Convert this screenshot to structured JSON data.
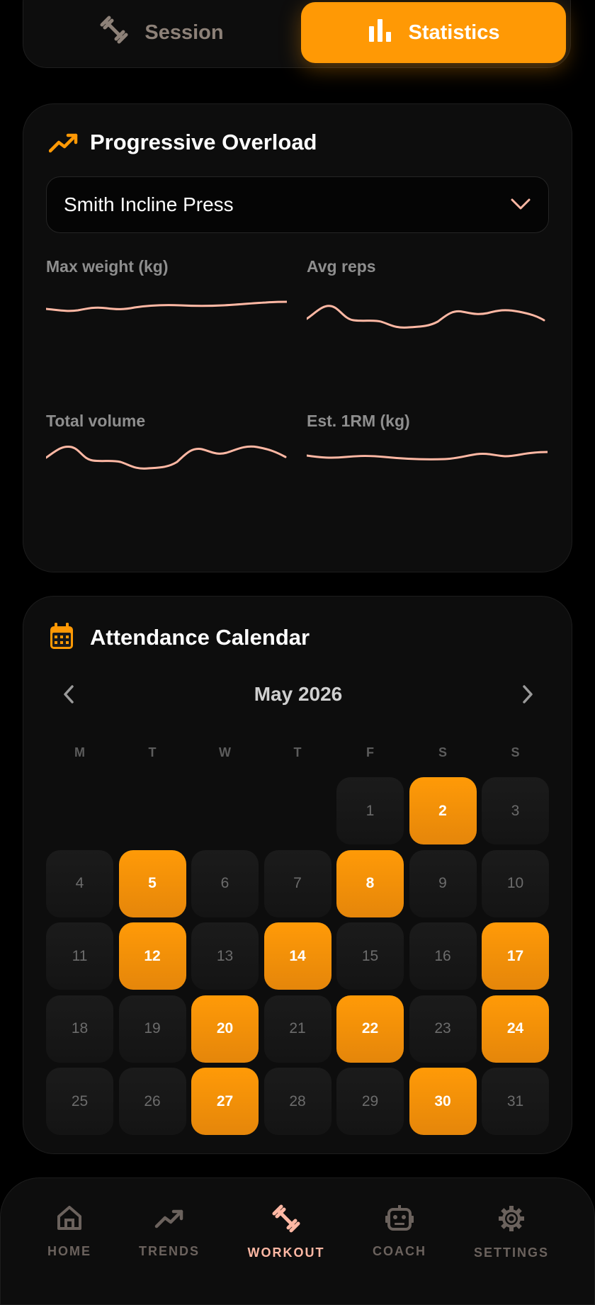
{
  "tabs": {
    "session_label": "Session",
    "statistics_label": "Statistics",
    "active": "Statistics"
  },
  "overload": {
    "title": "Progressive Overload",
    "selected_exercise": "Smith Incline Press",
    "metrics": [
      {
        "label": "Max weight (kg)"
      },
      {
        "label": "Avg reps"
      },
      {
        "label": "Total volume"
      },
      {
        "label": "Est. 1RM (kg)"
      }
    ]
  },
  "calendar": {
    "title": "Attendance Calendar",
    "month_label": "May 2026",
    "weekdays": [
      "M",
      "T",
      "W",
      "T",
      "F",
      "S",
      "S"
    ],
    "first_weekday_index": 4,
    "days_in_month": 31,
    "attended_days": [
      2,
      5,
      8,
      12,
      14,
      17,
      20,
      22,
      24,
      27,
      30
    ]
  },
  "bottom_nav": {
    "items": [
      {
        "label": "HOME",
        "icon": "home-icon"
      },
      {
        "label": "TRENDS",
        "icon": "trend-up-icon"
      },
      {
        "label": "WORKOUT",
        "icon": "dumbbell-icon"
      },
      {
        "label": "COACH",
        "icon": "robot-icon"
      },
      {
        "label": "SETTINGS",
        "icon": "gear-icon"
      }
    ],
    "active": "WORKOUT"
  },
  "colors": {
    "accent": "#ff9905",
    "sparkline": "#ffb8a4",
    "inactive_text": "#8d8178",
    "background": "#000000",
    "card": "#0d0d0d"
  }
}
